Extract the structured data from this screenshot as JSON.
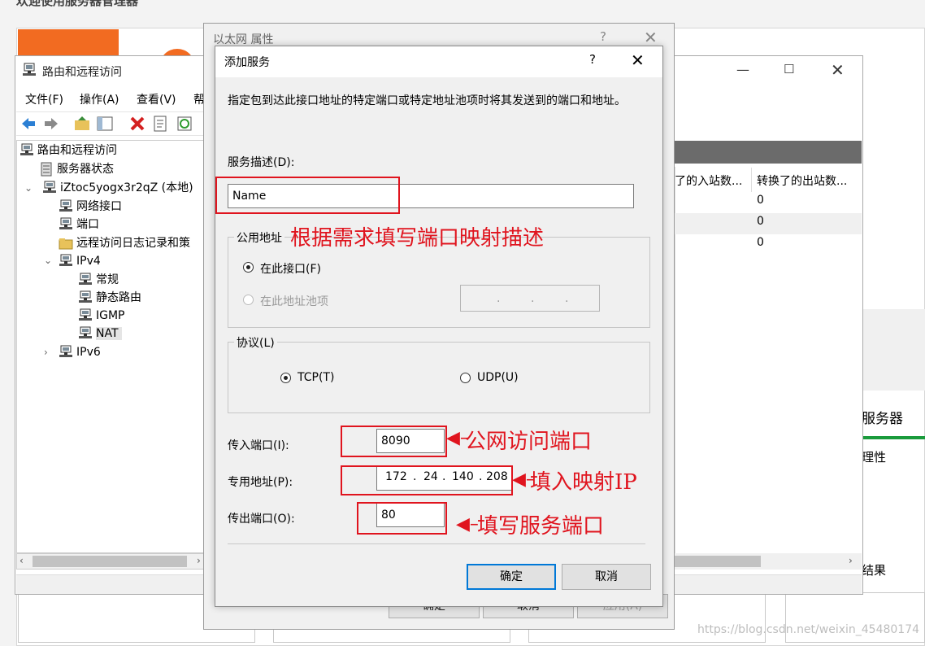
{
  "background": {
    "title": "欢迎使用服务器管理器",
    "server_label": "服务器",
    "properties_label": "理性",
    "results_label": "结果"
  },
  "rra_window": {
    "title": "路由和远程访问",
    "menu": [
      "文件(F)",
      "操作(A)",
      "查看(V)",
      "帮"
    ],
    "tree": [
      {
        "label": "路由和远程访问",
        "level": 0
      },
      {
        "label": "服务器状态",
        "level": 1
      },
      {
        "label": "iZtoc5yogx3r2qZ (本地)",
        "level": 1
      },
      {
        "label": "网络接口",
        "level": 2
      },
      {
        "label": "端口",
        "level": 2
      },
      {
        "label": "远程访问日志记录和策",
        "level": 2
      },
      {
        "label": "IPv4",
        "level": 2
      },
      {
        "label": "常规",
        "level": 3
      },
      {
        "label": "静态路由",
        "level": 3
      },
      {
        "label": "IGMP",
        "level": 3
      },
      {
        "label": "NAT",
        "level": 3,
        "selected": true
      },
      {
        "label": "IPv6",
        "level": 2
      }
    ],
    "columns": [
      "了的入站数...",
      "转换了的出站数..."
    ],
    "rows": [
      "0",
      "0",
      "0"
    ]
  },
  "eth_dialog": {
    "title": "以太网 属性",
    "help": "?",
    "buttons": [
      "确定",
      "取消",
      "应用(A)"
    ]
  },
  "add_service": {
    "title": "添加服务",
    "help": "?",
    "description": "指定包到达此接口地址的特定端口或特定地址池项时将其发送到的端口和地址。",
    "service_desc_label": "服务描述(D):",
    "service_desc_value": "Name",
    "public_address_group": "公用地址",
    "radio_this_interface": "在此接口(F)",
    "radio_address_pool": "在此地址池项",
    "protocol_group": "协议(L)",
    "protocol_tcp": "TCP(T)",
    "protocol_udp": "UDP(U)",
    "incoming_port_label": "传入端口(I):",
    "incoming_port_value": "8090",
    "private_address_label": "专用地址(P):",
    "private_ip": [
      "172",
      "24",
      "140",
      "208"
    ],
    "outgoing_port_label": "传出端口(O):",
    "outgoing_port_value": "80",
    "ok": "确定",
    "cancel": "取消"
  },
  "annotations": {
    "desc_note": "根据需求填写端口映射描述",
    "public_port_note": "公网访问端口",
    "ip_note": "填入映射IP",
    "service_port_note": "填写服务端口"
  },
  "watermark": "https://blog.csdn.net/weixin_45480174",
  "colors": {
    "accent_orange": "#f26b21",
    "annotation_red": "#e0141e",
    "focus_blue": "#0078d7"
  }
}
